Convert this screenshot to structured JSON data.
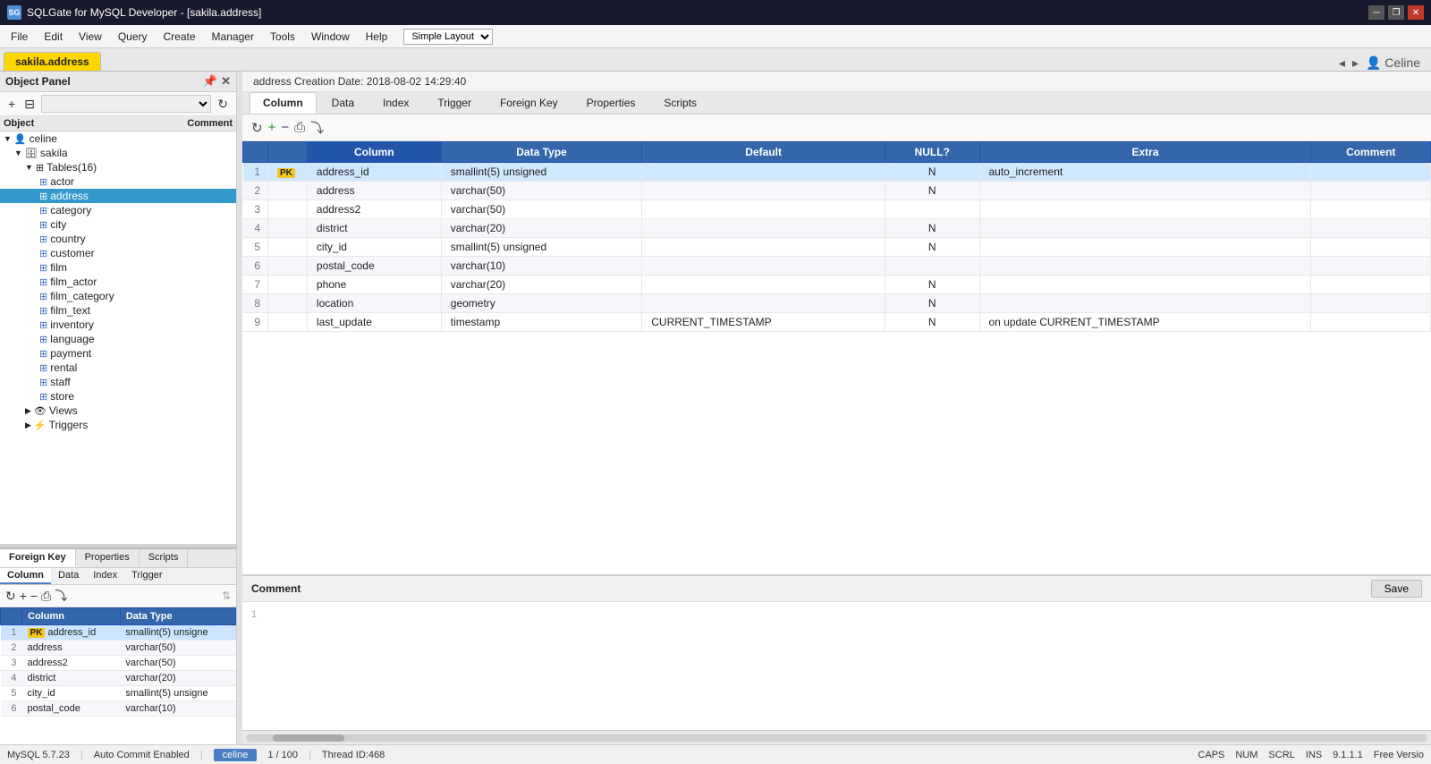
{
  "titlebar": {
    "app_name": "SQLGate for MySQL Developer - [sakila.address]",
    "icon": "SG"
  },
  "menubar": {
    "items": [
      "File",
      "Edit",
      "View",
      "Query",
      "Create",
      "Manager",
      "Tools",
      "Window",
      "Help"
    ],
    "layout_select": "Simple Layout"
  },
  "tabs": {
    "active": "sakila.address",
    "items": [
      "sakila.address"
    ]
  },
  "top_right_nav": {
    "user": "Celine",
    "arrows": [
      "◂",
      "▸"
    ]
  },
  "object_panel": {
    "title": "Object Panel",
    "toolbar": {
      "add_btn": "+",
      "grid_btn": "⊟",
      "filter_placeholder": " "
    },
    "columns": [
      "Object",
      "Comment"
    ],
    "tree": {
      "root": "celine",
      "sakila": "sakila",
      "tables_label": "Tables(16)",
      "tables": [
        "actor",
        "address",
        "category",
        "city",
        "country",
        "customer",
        "film",
        "film_actor",
        "film_category",
        "film_text",
        "inventory",
        "language",
        "payment",
        "rental",
        "staff",
        "store"
      ],
      "views_label": "Views",
      "triggers_label": "Triggers"
    }
  },
  "info_bar": {
    "text": "address Creation Date: 2018-08-02 14:29:40"
  },
  "main_tabs": {
    "items": [
      "Column",
      "Data",
      "Index",
      "Trigger",
      "Foreign Key",
      "Properties",
      "Scripts"
    ],
    "active": "Column"
  },
  "content_toolbar": {
    "refresh": "↻",
    "add": "+",
    "remove": "−",
    "print": "⎙",
    "export": "⤵"
  },
  "table": {
    "columns": [
      "",
      "Column",
      "Data Type",
      "Default",
      "NULL?",
      "Extra",
      "Comment"
    ],
    "rows": [
      {
        "num": 1,
        "pk": "PK",
        "column": "address_id",
        "data_type": "smallint(5) unsigned",
        "default": "",
        "null": "N",
        "extra": "auto_increment",
        "comment": ""
      },
      {
        "num": 2,
        "pk": "",
        "column": "address",
        "data_type": "varchar(50)",
        "default": "",
        "null": "N",
        "extra": "",
        "comment": ""
      },
      {
        "num": 3,
        "pk": "",
        "column": "address2",
        "data_type": "varchar(50)",
        "default": "",
        "null": "",
        "extra": "",
        "comment": ""
      },
      {
        "num": 4,
        "pk": "",
        "column": "district",
        "data_type": "varchar(20)",
        "default": "",
        "null": "N",
        "extra": "",
        "comment": ""
      },
      {
        "num": 5,
        "pk": "",
        "column": "city_id",
        "data_type": "smallint(5) unsigned",
        "default": "",
        "null": "N",
        "extra": "",
        "comment": ""
      },
      {
        "num": 6,
        "pk": "",
        "column": "postal_code",
        "data_type": "varchar(10)",
        "default": "",
        "null": "",
        "extra": "",
        "comment": ""
      },
      {
        "num": 7,
        "pk": "",
        "column": "phone",
        "data_type": "varchar(20)",
        "default": "",
        "null": "N",
        "extra": "",
        "comment": ""
      },
      {
        "num": 8,
        "pk": "",
        "column": "location",
        "data_type": "geometry",
        "default": "",
        "null": "N",
        "extra": "",
        "comment": ""
      },
      {
        "num": 9,
        "pk": "",
        "column": "last_update",
        "data_type": "timestamp",
        "default": "CURRENT_TIMESTAMP",
        "null": "N",
        "extra": "on update CURRENT_TIMESTAMP",
        "comment": ""
      }
    ]
  },
  "lower_panel": {
    "tabs": [
      "Foreign Key",
      "Properties",
      "Scripts"
    ],
    "active_tab": "Foreign Key",
    "sub_tabs": [
      "Column",
      "Data",
      "Index",
      "Trigger"
    ],
    "active_sub": "Column",
    "table_columns": [
      "",
      "Column",
      "Data Type"
    ],
    "table_rows": [
      {
        "num": 1,
        "pk": "PK",
        "column": "address_id",
        "data_type": "smallint(5) unsigne"
      },
      {
        "num": 2,
        "pk": "",
        "column": "address",
        "data_type": "varchar(50)"
      },
      {
        "num": 3,
        "pk": "",
        "column": "address2",
        "data_type": "varchar(50)"
      },
      {
        "num": 4,
        "pk": "",
        "column": "district",
        "data_type": "varchar(20)"
      },
      {
        "num": 5,
        "pk": "",
        "column": "city_id",
        "data_type": "smallint(5) unsigne"
      },
      {
        "num": 6,
        "pk": "",
        "column": "postal_code",
        "data_type": "varchar(10)"
      }
    ]
  },
  "comment_section": {
    "label": "Comment",
    "save_btn": "Save",
    "line_num": "1"
  },
  "status_bar": {
    "mysql_version": "MySQL 5.7.23",
    "auto_commit": "Auto Commit Enabled",
    "user_tab": "celine",
    "page_info": "1 / 100",
    "thread_id": "Thread ID:468",
    "caps": "CAPS",
    "num": "NUM",
    "scrl": "SCRL",
    "ins": "INS",
    "version": "9.1.1.1",
    "free": "Free Versio"
  }
}
